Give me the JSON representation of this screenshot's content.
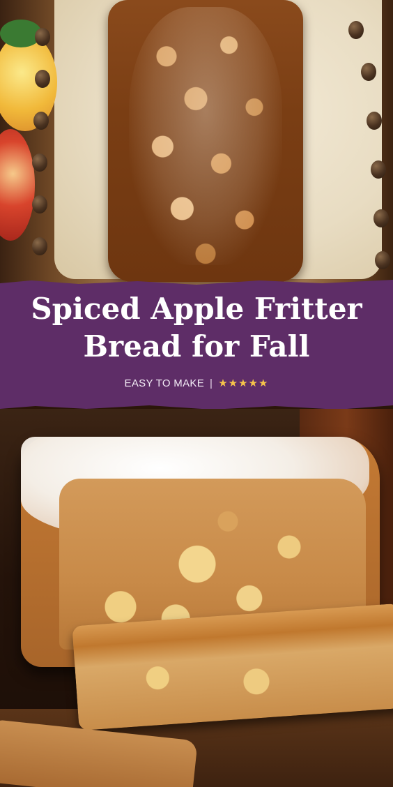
{
  "pin": {
    "title_line1": "Spiced Apple Fritter",
    "title_line2": "Bread for Fall",
    "subtitle_text": "EASY TO MAKE",
    "separator": "|",
    "stars": "★★★★★",
    "colors": {
      "banner_background": "#5e2d67",
      "title_text": "#ffffff",
      "stars": "#f6c44a"
    },
    "rating_stars": 5
  }
}
